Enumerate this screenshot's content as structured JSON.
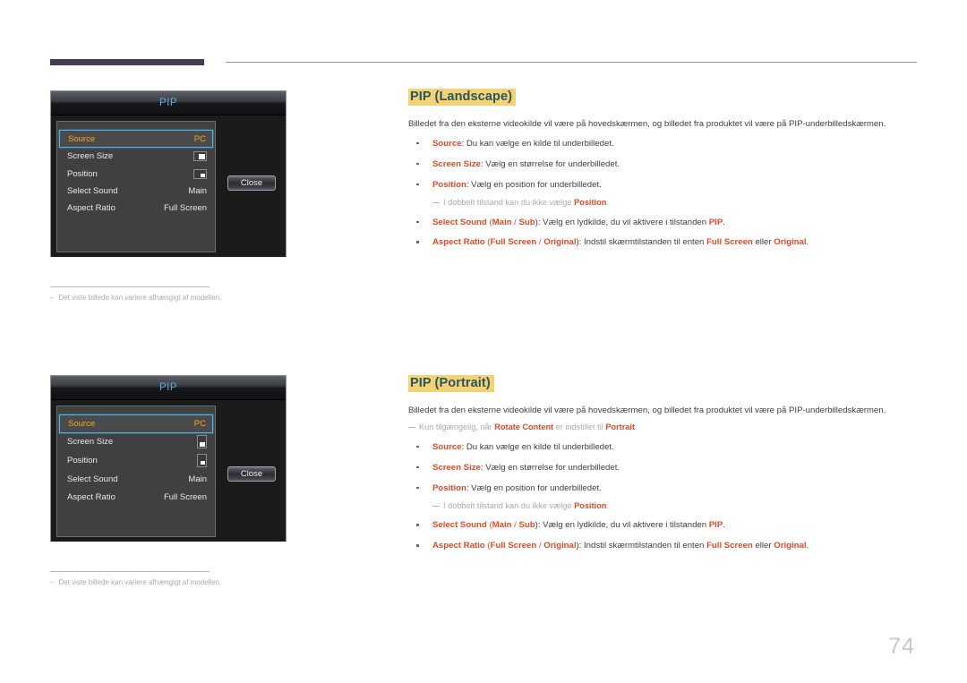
{
  "page": {
    "number": "74"
  },
  "osd_landscape": {
    "title": "PIP",
    "rows": [
      {
        "label": "Source",
        "value": "PC",
        "type": "text",
        "selected": true
      },
      {
        "label": "Screen Size",
        "value": "",
        "type": "icon-size",
        "selected": false
      },
      {
        "label": "Position",
        "value": "",
        "type": "icon-pos",
        "selected": false
      },
      {
        "label": "Select Sound",
        "value": "Main",
        "type": "text",
        "selected": false
      },
      {
        "label": "Aspect Ratio",
        "value": "Full Screen",
        "type": "text",
        "selected": false
      }
    ],
    "close_label": "Close",
    "footnote": "Det viste billede kan variere afhængigt af modellen."
  },
  "osd_portrait": {
    "title": "PIP",
    "rows": [
      {
        "label": "Source",
        "value": "PC",
        "type": "text",
        "selected": true
      },
      {
        "label": "Screen Size",
        "value": "",
        "type": "icon-size",
        "selected": false
      },
      {
        "label": "Position",
        "value": "",
        "type": "icon-pos",
        "selected": false
      },
      {
        "label": "Select Sound",
        "value": "Main",
        "type": "text",
        "selected": false
      },
      {
        "label": "Aspect Ratio",
        "value": "Full Screen",
        "type": "text",
        "selected": false
      }
    ],
    "close_label": "Close",
    "footnote": "Det viste billede kan variere afhængigt af modellen."
  },
  "section_landscape": {
    "heading": "PIP (Landscape)",
    "intro": "Billedet fra den eksterne videokilde vil være på hovedskærmen, og billedet fra produktet vil være på PIP-underbilledskærmen.",
    "bullets": {
      "b1_kw": "Source",
      "b1_rest": ": Du kan vælge en kilde til underbilledet.",
      "b2_kw": "Screen Size",
      "b2_rest": ": Vælg en størrelse for underbilledet.",
      "b3_kw": "Position",
      "b3_rest": ": Vælg en position for underbilledet.",
      "note_pre": "I dobbelt tilstand kan du ikke vælge ",
      "note_kw": "Position",
      "note_post": ".",
      "b4_kw": "Select Sound",
      "b4_open": " (",
      "b4_kw2": "Main",
      "b4_sep": " / ",
      "b4_kw3": "Sub",
      "b4_close": "): Vælg en lydkilde, du vil aktivere i tilstanden ",
      "b4_kw4": "PIP",
      "b4_end": ".",
      "b5_kw": "Aspect Ratio",
      "b5_open": " (",
      "b5_kw2": "Full Screen",
      "b5_sep": " / ",
      "b5_kw3": "Original",
      "b5_close": "): Indstil skærmtilstanden til enten ",
      "b5_kw4": "Full Screen",
      "b5_mid": " eller ",
      "b5_kw5": "Original",
      "b5_end": "."
    }
  },
  "section_portrait": {
    "heading": "PIP (Portrait)",
    "intro": "Billedet fra den eksterne videokilde vil være på hovedskærmen, og billedet fra produktet vil være på PIP-underbilledskærmen.",
    "avail_pre": "Kun tilgængelig, når ",
    "avail_kw": "Rotate Content",
    "avail_mid": " er indstillet til ",
    "avail_kw2": "Portrait",
    "avail_end": ".",
    "bullets": {
      "b1_kw": "Source",
      "b1_rest": ": Du kan vælge en kilde til underbilledet.",
      "b2_kw": "Screen Size",
      "b2_rest": ": Vælg en størrelse for underbilledet.",
      "b3_kw": "Position",
      "b3_rest": ": Vælg en position for underbilledet.",
      "note_pre": "I dobbelt tilstand kan du ikke vælge ",
      "note_kw": "Position",
      "note_post": ".",
      "b4_kw": "Select Sound",
      "b4_open": " (",
      "b4_kw2": "Main",
      "b4_sep": " / ",
      "b4_kw3": "Sub",
      "b4_close": "): Vælg en lydkilde, du vil aktivere i tilstanden ",
      "b4_kw4": "PIP",
      "b4_end": ".",
      "b5_kw": "Aspect Ratio",
      "b5_open": " (",
      "b5_kw2": "Full Screen",
      "b5_sep": " / ",
      "b5_kw3": "Original",
      "b5_close": "): Indstil skærmtilstanden til enten ",
      "b5_kw4": "Full Screen",
      "b5_mid": " eller ",
      "b5_kw5": "Original",
      "b5_end": "."
    }
  },
  "colors": {
    "heading_highlight": "#f2d275",
    "heading_text": "#2c5560",
    "keyword": "#e04a26",
    "osd_select_border": "#49b6ef",
    "osd_select_text": "#f0a81e",
    "osd_title_text": "#5fa9e0",
    "header_bar": "#453c52"
  }
}
